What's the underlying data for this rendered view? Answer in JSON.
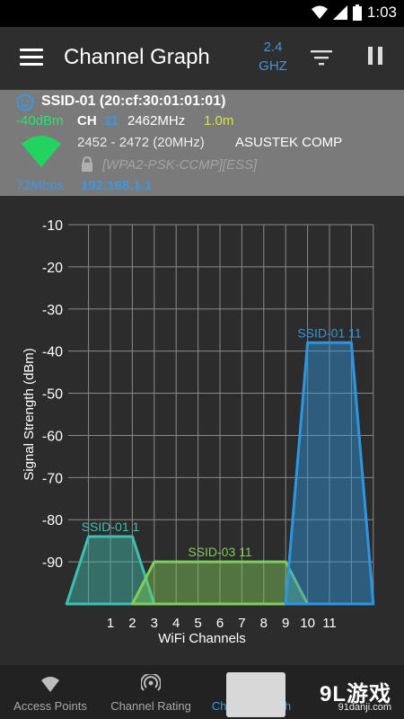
{
  "status_bar": {
    "time": "1:03"
  },
  "toolbar": {
    "title": "Channel Graph",
    "band_line1": "2.4",
    "band_line2": "GHZ"
  },
  "access_point": {
    "ssid_title": "SSID-01 (20:cf:30:01:01:01)",
    "signal": "-40dBm",
    "channel_label": "CH",
    "channel": "11",
    "frequency": "2462MHz",
    "distance": "1.0m",
    "frequency_range": "2452 - 2472 (20MHz)",
    "vendor": "ASUSTEK COMP",
    "security": "[WPA2-PSK-CCMP][ESS]",
    "speed": "72Mbps",
    "ip": "192.168.1.1"
  },
  "chart_data": {
    "type": "area",
    "ylabel": "Signal Strength (dBm)",
    "xlabel": "WiFi Channels",
    "ylim": [
      -100,
      -10
    ],
    "y_ticks": [
      "-10",
      "-20",
      "-30",
      "-40",
      "-50",
      "-60",
      "-70",
      "-80",
      "-90"
    ],
    "x_ticks": [
      "1",
      "2",
      "3",
      "4",
      "5",
      "6",
      "7",
      "8",
      "9",
      "10",
      "11"
    ],
    "grid": true,
    "series": [
      {
        "name": "SSID-01 1",
        "channel": 1,
        "width_channels": 4,
        "level": -84,
        "color": "#3fbfb0"
      },
      {
        "name": "SSID-03 11",
        "channel": 6,
        "width_channels": 8,
        "level": -90,
        "color": "#7ecf5a"
      },
      {
        "name": "SSID-01 11",
        "channel": 11,
        "width_channels": 4,
        "level": -38,
        "color": "#2e96e0"
      }
    ]
  },
  "bottom_nav": {
    "items": [
      {
        "label": "Access Points"
      },
      {
        "label": "Channel Rating"
      },
      {
        "label": "Channel Graph"
      }
    ]
  },
  "watermark": {
    "brand": "9L游戏",
    "url": "91danji.com"
  }
}
